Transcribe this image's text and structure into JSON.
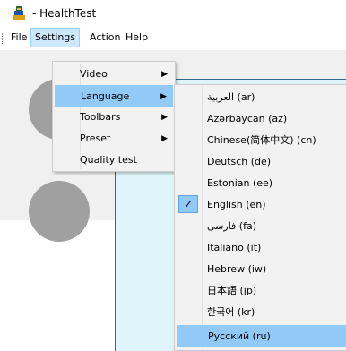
{
  "window": {
    "title": "- HealthTest"
  },
  "menubar": {
    "items": [
      {
        "label": "File"
      },
      {
        "label": "Settings"
      },
      {
        "label": "Action"
      },
      {
        "label": "Help"
      }
    ]
  },
  "settings_menu": {
    "items": [
      {
        "label": "Video",
        "has_submenu": true
      },
      {
        "label": "Language",
        "has_submenu": true,
        "highlighted": true
      },
      {
        "label": "Toolbars",
        "has_submenu": true
      },
      {
        "label": "Preset",
        "has_submenu": true
      },
      {
        "label": "Quality test",
        "has_submenu": false
      }
    ]
  },
  "language_menu": {
    "items": [
      {
        "label": "العربية (ar)",
        "checked": false
      },
      {
        "label": "Azərbaycan (az)",
        "checked": false
      },
      {
        "label": "Chinese(简体中文) (cn)",
        "checked": false
      },
      {
        "label": "Deutsch (de)",
        "checked": false
      },
      {
        "label": "Estonian (ee)",
        "checked": false
      },
      {
        "label": "English (en)",
        "checked": true
      },
      {
        "label": "فارسی (fa)",
        "checked": false
      },
      {
        "label": "Italiano (it)",
        "checked": false
      },
      {
        "label": "Hebrew (iw)",
        "checked": false
      },
      {
        "label": "日本語 (jp)",
        "checked": false
      },
      {
        "label": "한국어 (kr)",
        "checked": false
      },
      {
        "label": "Русский (ru)",
        "checked": false,
        "highlighted": true
      }
    ]
  },
  "icons": {
    "app": "app-icon",
    "check": "✓",
    "submenu_arrow": "▶"
  },
  "colors": {
    "menu_highlight": "#91c9f7",
    "menubar_active": "#cce8ff",
    "canvas_bg": "#dff5fb",
    "placeholder_circle": "#a0a0a0"
  }
}
